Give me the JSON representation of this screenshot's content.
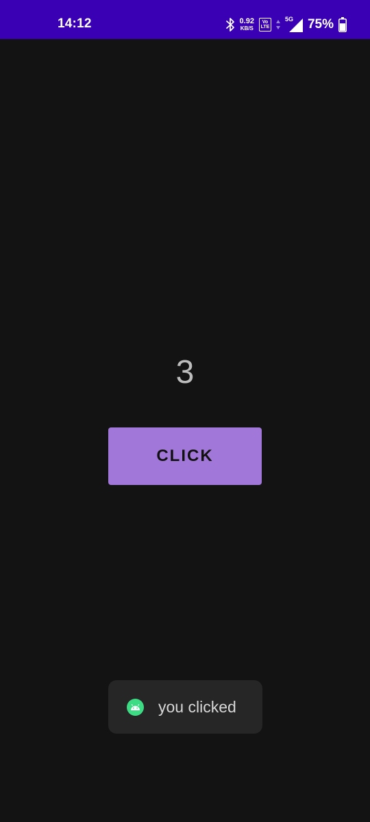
{
  "status_bar": {
    "time": "14:12",
    "icons": [
      "bluetooth-icon",
      "volte-icon",
      "data-arrows-icon",
      "signal-icon",
      "battery-icon"
    ],
    "net_speed_value": "0.92",
    "net_speed_unit": "KB/S",
    "volte_top": "Vo",
    "volte_bottom": "LTE",
    "network_type": "5G",
    "battery_percent": "75%",
    "battery_level": 0.75,
    "background_color": "#3a00b3"
  },
  "main": {
    "counter_value": "3",
    "button_label": "CLICK",
    "button_color": "#a178d9",
    "background_color": "#131313"
  },
  "toast": {
    "icon": "android-icon",
    "icon_color": "#3ddc84",
    "message": "you clicked"
  }
}
